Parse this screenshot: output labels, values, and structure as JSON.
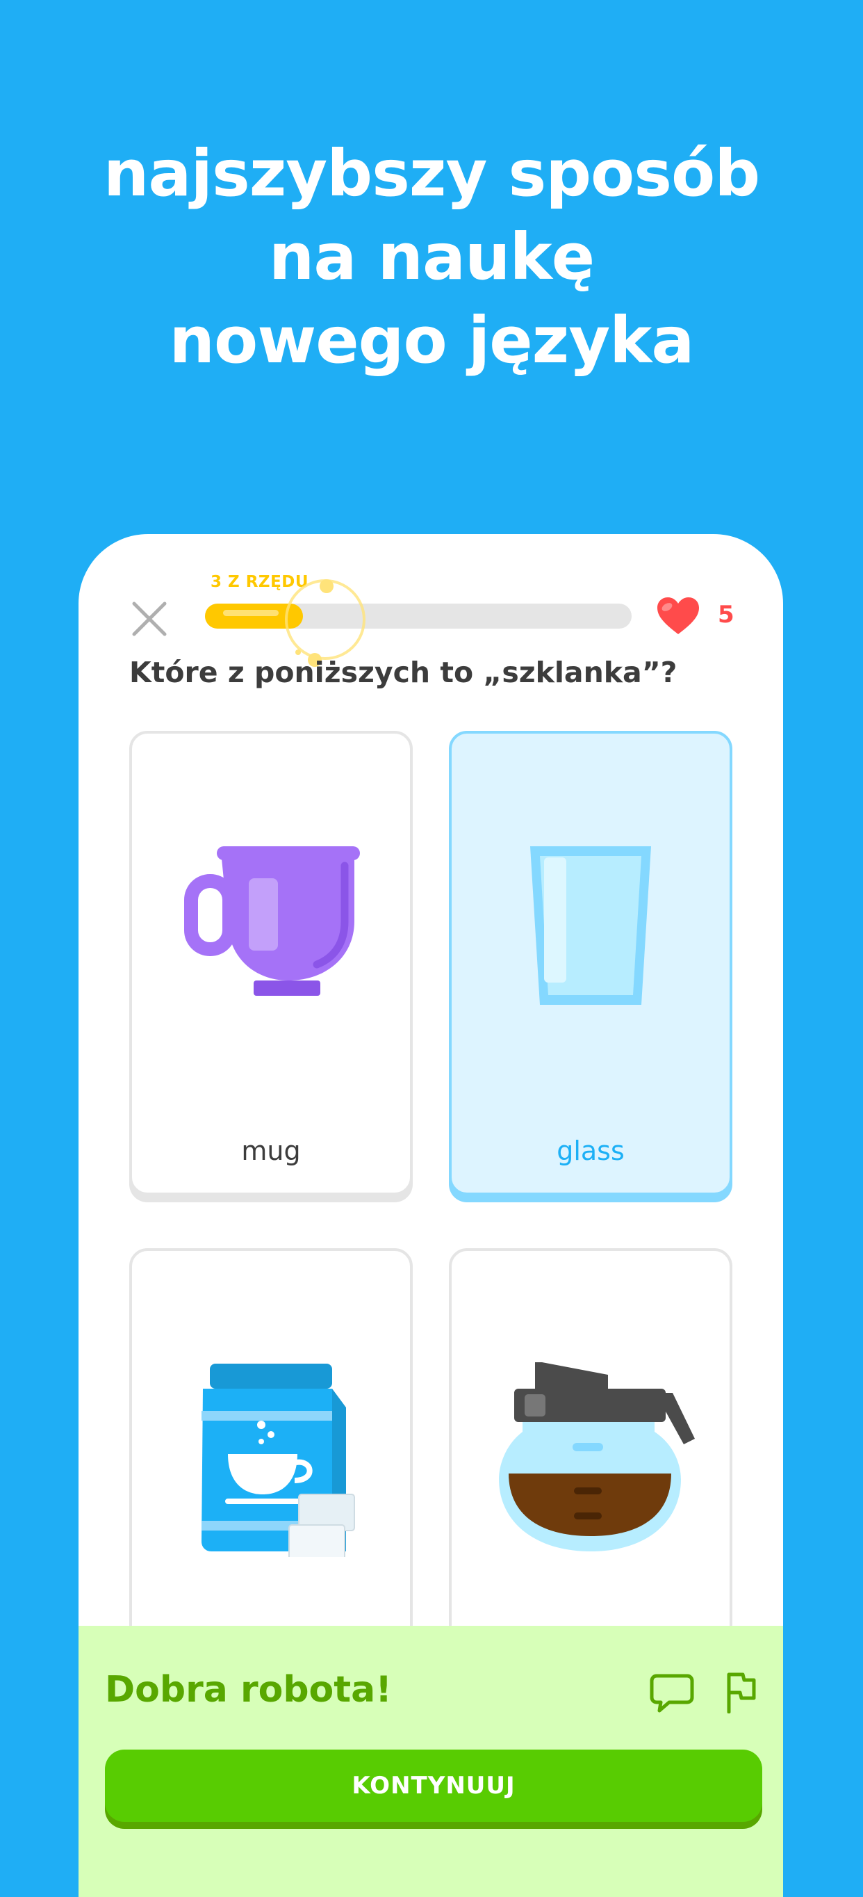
{
  "headline": {
    "line1": "najszybszy sposób",
    "line2": "na naukę",
    "line3": "nowego języka"
  },
  "lesson": {
    "streak_label": "3 Z RZĘDU",
    "progress": 0.23,
    "hearts": "5",
    "question": "Które z poniższych to „szklanka”?",
    "options": [
      {
        "label": "mug",
        "icon": "mug-icon",
        "selected": false
      },
      {
        "label": "glass",
        "icon": "glass-icon",
        "selected": true
      },
      {
        "label": "",
        "icon": "coffee-bag-icon",
        "selected": false
      },
      {
        "label": "",
        "icon": "coffee-pot-icon",
        "selected": false
      }
    ]
  },
  "feedback": {
    "title": "Dobra robota!",
    "continue_label": "KONTYNUUJ"
  },
  "colors": {
    "background": "#1FAEF5",
    "progress": "#FFC800",
    "heart": "#FF4B4B",
    "selected_border": "#84D8FF",
    "success_bg": "#D7FFB8",
    "success_text": "#58A700",
    "button": "#58CC02"
  }
}
